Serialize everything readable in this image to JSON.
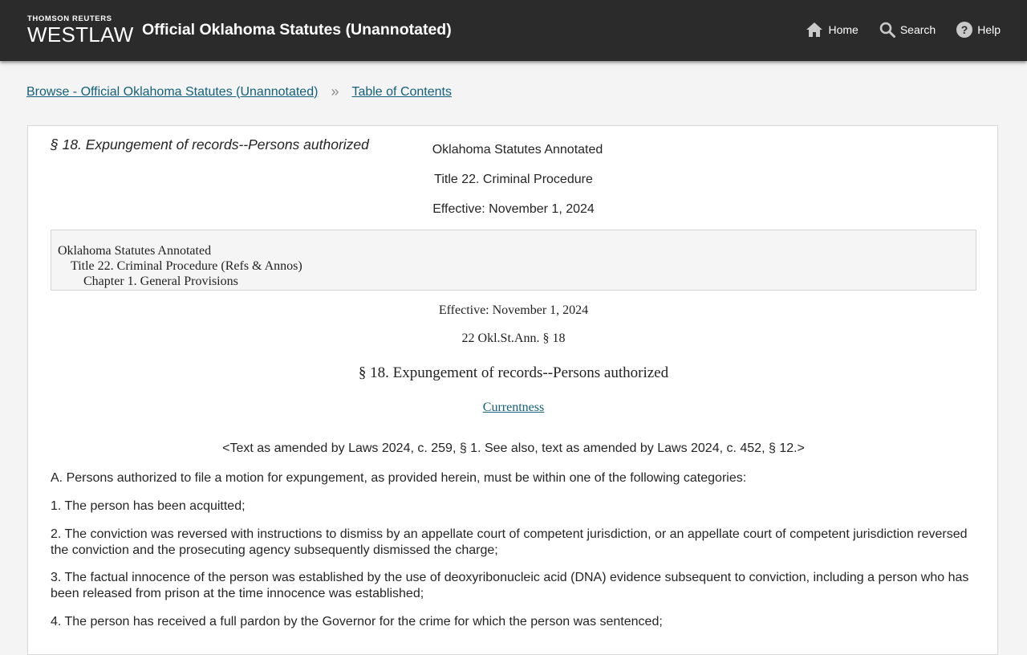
{
  "header": {
    "brand_small": "THOMSON REUTERS",
    "brand_big": "WESTLAW",
    "title": "Official Oklahoma Statutes (Unannotated)",
    "nav": [
      {
        "label": "Home",
        "icon": "home-icon"
      },
      {
        "label": "Search",
        "icon": "search-icon"
      },
      {
        "label": "Help",
        "icon": "help-icon"
      }
    ]
  },
  "breadcrumb": {
    "items": [
      "Browse - Official Oklahoma Statutes (Unannotated)",
      "Table of Contents"
    ],
    "separator": "»"
  },
  "document": {
    "heading": "§ 18. Expungement of records--Persons authorized",
    "publication": "Oklahoma Statutes Annotated",
    "title": "Title 22. Criminal Procedure",
    "effective": "Effective: November 1, 2024",
    "hierarchy": [
      "Oklahoma Statutes Annotated",
      "Title 22. Criminal Procedure (Refs & Annos)",
      "Chapter 1. General Provisions"
    ],
    "effective2": "Effective: November 1, 2024",
    "citation": "22 Okl.St.Ann. § 18",
    "section_heading": "§ 18. Expungement of records--Persons authorized",
    "currentness_link": "Currentness",
    "amend_note": "<Text as amended by Laws 2024, c. 259, § 1. See also, text as amended by Laws 2024, c. 452, § 12.>",
    "paragraphs": [
      "A. Persons authorized to file a motion for expungement, as provided herein, must be within one of the following categories:",
      "1. The person has been acquitted;",
      "2. The conviction was reversed with instructions to dismiss by an appellate court of competent jurisdiction, or an appellate court of competent jurisdiction reversed the conviction and the prosecuting agency subsequently dismissed the charge;",
      "3. The factual innocence of the person was established by the use of deoxyribonucleic acid (DNA) evidence subsequent to conviction, including a person who has been released from prison at the time innocence was established;",
      "4. The person has received a full pardon by the Governor for the crime for which the person was sentenced;"
    ]
  },
  "colors": {
    "header_bg": "#2b2b2b",
    "link": "#14607a",
    "page_bg": "#f4f4f4"
  }
}
